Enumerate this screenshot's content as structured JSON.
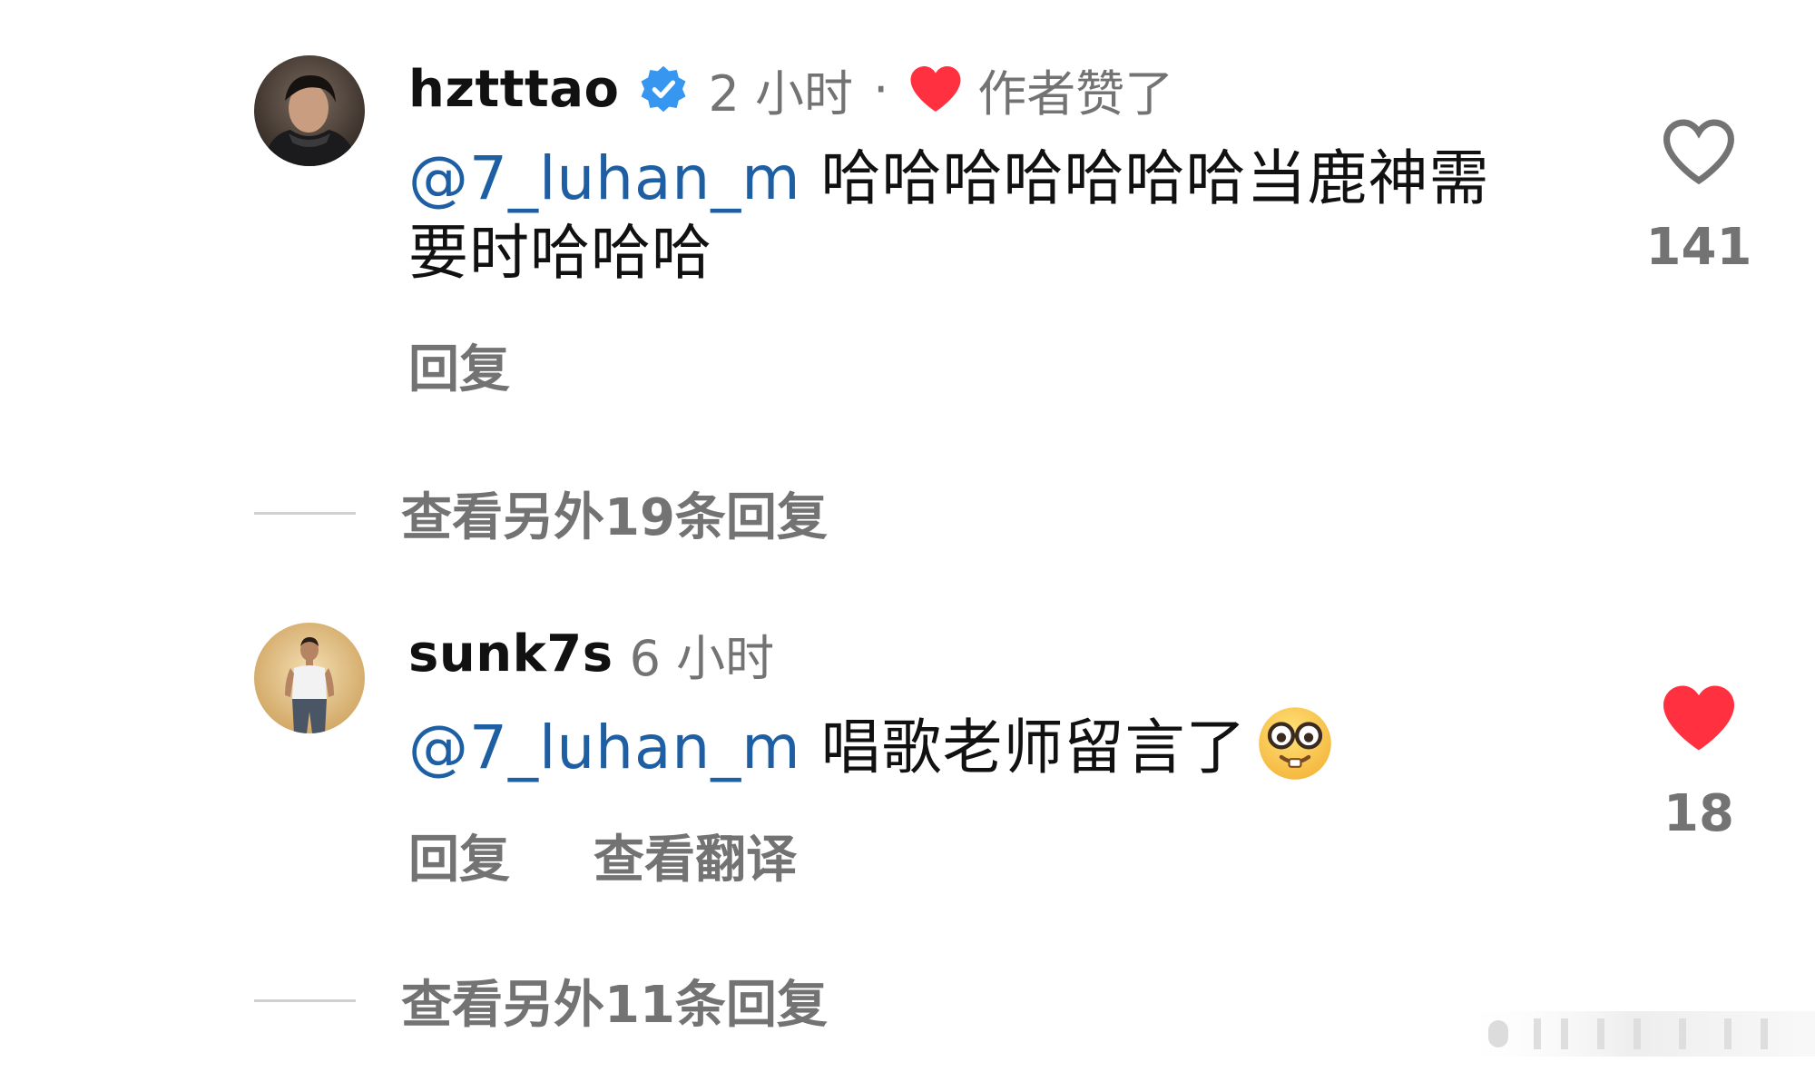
{
  "comments": [
    {
      "username": "hztttao",
      "verified": true,
      "time": "2 小时",
      "separator": "·",
      "author_liked_label": "作者赞了",
      "mention": "@7_luhan_m",
      "text_line1": " 哈哈哈哈哈哈哈当鹿神需",
      "text_line2": "要时哈哈哈",
      "reply_label": "回复",
      "likes": "141",
      "liked": false,
      "view_replies": "查看另外19条回复"
    },
    {
      "username": "sunk7s",
      "verified": false,
      "time": "6 小时",
      "mention": "@7_luhan_m",
      "text": " 唱歌老师留言了",
      "emoji": "nerd-face-emoji",
      "reply_label": "回复",
      "translate_label": "查看翻译",
      "likes": "18",
      "liked": true,
      "view_replies": "查看另外11条回复"
    }
  ],
  "colors": {
    "mention": "#1e5fa3",
    "meta_gray": "#737373",
    "heart_red": "#ff3040",
    "verified_blue": "#3797f0"
  }
}
